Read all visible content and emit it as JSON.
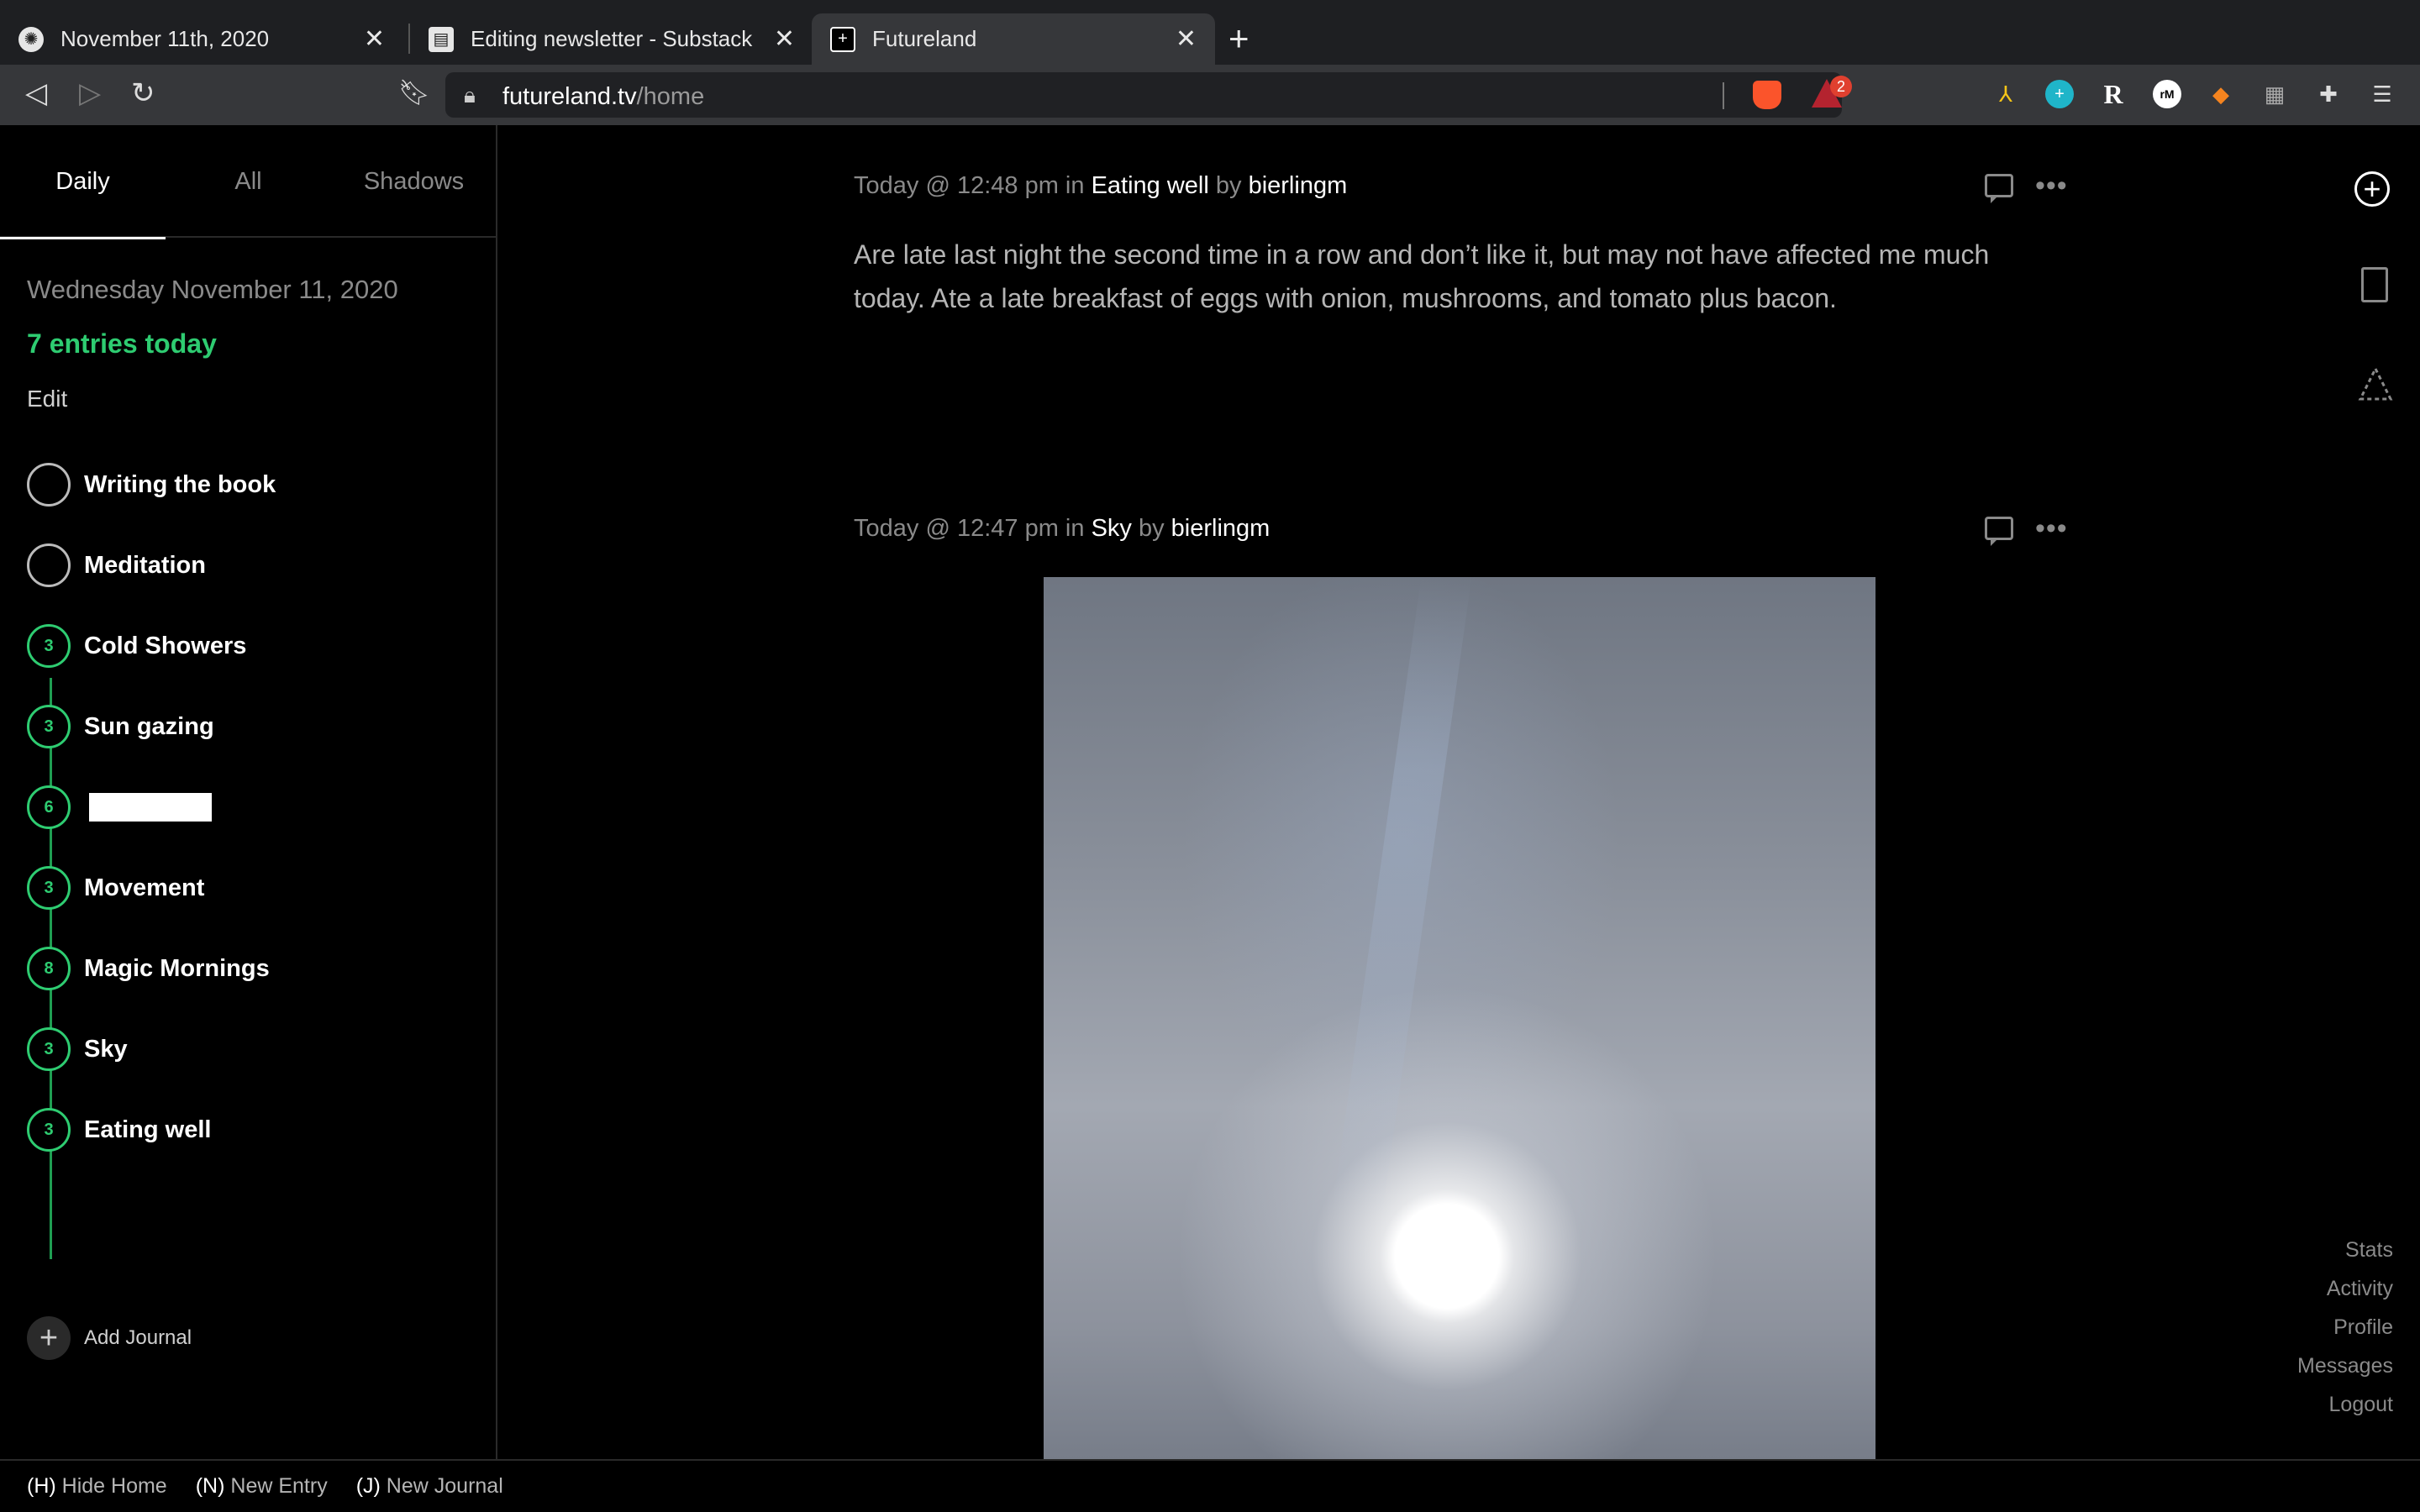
{
  "browser": {
    "tabs": [
      {
        "title": "November 11th, 2020",
        "close": "✕"
      },
      {
        "title": "Editing newsletter - Substack",
        "close": "✕"
      },
      {
        "title": "Futureland",
        "close": "✕"
      }
    ],
    "new_tab": "+",
    "url": {
      "host": "futureland.tv",
      "path": "/home"
    },
    "rewards_badge": "2",
    "accent": "#fb542b"
  },
  "sidebar": {
    "tabs": [
      "Daily",
      "All",
      "Shadows"
    ],
    "date": "Wednesday November 11, 2020",
    "entries_today": "7 entries today",
    "edit": "Edit",
    "journals": [
      {
        "name": "Writing the book",
        "count": ""
      },
      {
        "name": "Meditation",
        "count": ""
      },
      {
        "name": "Cold Showers",
        "count": "3"
      },
      {
        "name": "Sun gazing",
        "count": "3"
      },
      {
        "name": "",
        "count": "6"
      },
      {
        "name": "Movement",
        "count": "3"
      },
      {
        "name": "Magic Mornings",
        "count": "8"
      },
      {
        "name": "Sky",
        "count": "3"
      },
      {
        "name": "Eating well",
        "count": "3"
      }
    ],
    "add_journal": "Add Journal",
    "accent": "#2ecc71"
  },
  "feed": {
    "entries": [
      {
        "time": "Today @ 12:48 pm",
        "in_word": "in",
        "journal": "Eating well",
        "by_word": "by",
        "author": "bierlingm",
        "body": "Are late last night the second time in a row and don’t like it, but may not have affected me much today. Ate a late breakfast of eggs with onion, mushrooms, and tomato plus bacon."
      },
      {
        "time": "Today @ 12:47 pm",
        "in_word": "in",
        "journal": "Sky",
        "by_word": "by",
        "author": "bierlingm"
      }
    ]
  },
  "rail": {
    "links": [
      "Stats",
      "Activity",
      "Profile",
      "Messages",
      "Logout"
    ]
  },
  "shortcuts": [
    {
      "key": "(H)",
      "label": " Hide Home"
    },
    {
      "key": "(N)",
      "label": " New Entry"
    },
    {
      "key": "(J)",
      "label": " New Journal"
    }
  ]
}
